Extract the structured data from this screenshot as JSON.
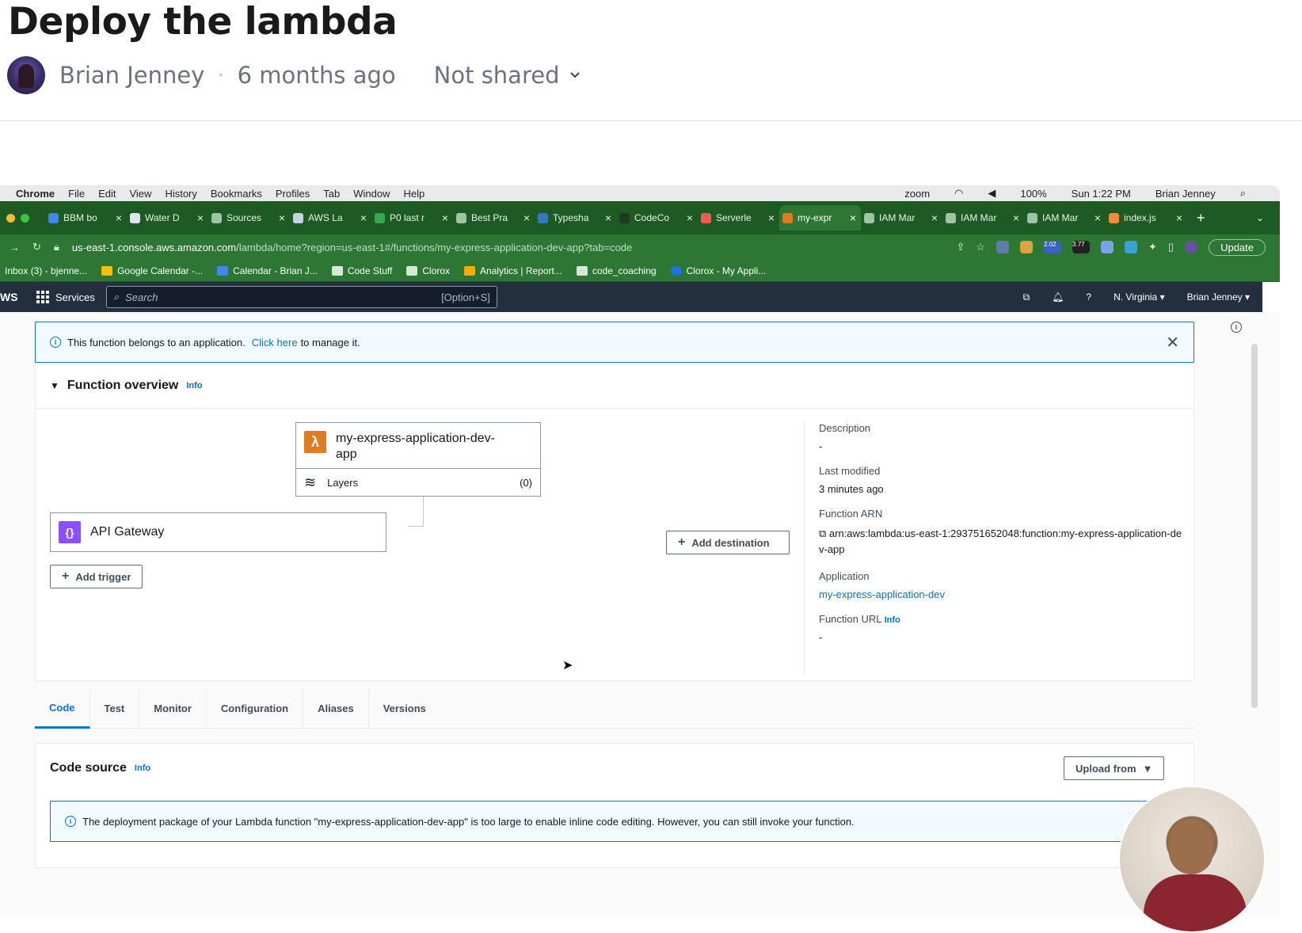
{
  "loom": {
    "title": "Deploy the lambda",
    "author": "Brian Jenney",
    "time_ago": "6 months ago",
    "sharing": "Not shared"
  },
  "mac_menu": {
    "items": [
      "Chrome",
      "File",
      "Edit",
      "View",
      "History",
      "Bookmarks",
      "Profiles",
      "Tab",
      "Window",
      "Help"
    ],
    "zoom": "zoom",
    "battery": "100%",
    "clock": "Sun 1:22 PM",
    "user": "Brian Jenney"
  },
  "tabs": [
    {
      "title": "BBM bo",
      "color": "#4285f4"
    },
    {
      "title": "Water D",
      "color": "#dfe6ee"
    },
    {
      "title": "Sources",
      "color": "#9fc4a3"
    },
    {
      "title": "AWS La",
      "color": "#c6d4e1"
    },
    {
      "title": "P0 last r",
      "color": "#34a853"
    },
    {
      "title": "Best Pra",
      "color": "#9fc4a3"
    },
    {
      "title": "Typesha",
      "color": "#3178c6"
    },
    {
      "title": "CodeCo",
      "color": "#1e3b22"
    },
    {
      "title": "Serverle",
      "color": "#fd5750"
    },
    {
      "title": "my-expr",
      "color": "#e07b1f",
      "active": true
    },
    {
      "title": "IAM Mar",
      "color": "#9fc4a3"
    },
    {
      "title": "IAM Mar",
      "color": "#9fc4a3"
    },
    {
      "title": "IAM Mar",
      "color": "#9fc4a3"
    },
    {
      "title": "index.js",
      "color": "#f28c38"
    }
  ],
  "url": {
    "host": "us-east-1.console.aws.amazon.com",
    "path": "/lambda/home?region=us-east-1#/functions/my-express-application-dev-app?tab=code",
    "update_label": "Update",
    "ext_badges": [
      "2.02",
      "3.77"
    ]
  },
  "bookmarks": [
    "Inbox (3) - bjenne...",
    "Google Calendar -...",
    "Calendar - Brian J...",
    "Code Stuff",
    "Clorox",
    "Analytics | Report...",
    "code_coaching",
    "Clorox - My Appli..."
  ],
  "aws_nav": {
    "logo": "WS",
    "services": "Services",
    "search_placeholder": "Search",
    "search_shortcut": "[Option+S]",
    "region": "N. Virginia ▾",
    "account": "Brian Jenney ▾"
  },
  "notice": {
    "text_before": "This function belongs to an application.",
    "link": "Click here",
    "text_after": "to manage it."
  },
  "function_overview": {
    "heading": "Function overview",
    "info": "Info",
    "function_name": "my-express-application-dev-app",
    "layers_label": "Layers",
    "layers_count": "(0)",
    "trigger_name": "API Gateway",
    "add_trigger": "Add trigger",
    "add_destination": "Add destination"
  },
  "details": {
    "description_label": "Description",
    "description_value": "-",
    "last_modified_label": "Last modified",
    "last_modified_value": "3 minutes ago",
    "arn_label": "Function ARN",
    "arn_value": "arn:aws:lambda:us-east-1:293751652048:function:my-express-application-dev-app",
    "application_label": "Application",
    "application_value": "my-express-application-dev",
    "url_label": "Function URL",
    "url_info": "Info",
    "url_value": "-"
  },
  "subtabs": [
    "Code",
    "Test",
    "Monitor",
    "Configuration",
    "Aliases",
    "Versions"
  ],
  "code_source": {
    "heading": "Code source",
    "info": "Info",
    "upload_label": "Upload from",
    "warning": "The deployment package of your Lambda function \"my-express-application-dev-app\" is too large to enable inline code editing. However, you can still invoke your function."
  }
}
